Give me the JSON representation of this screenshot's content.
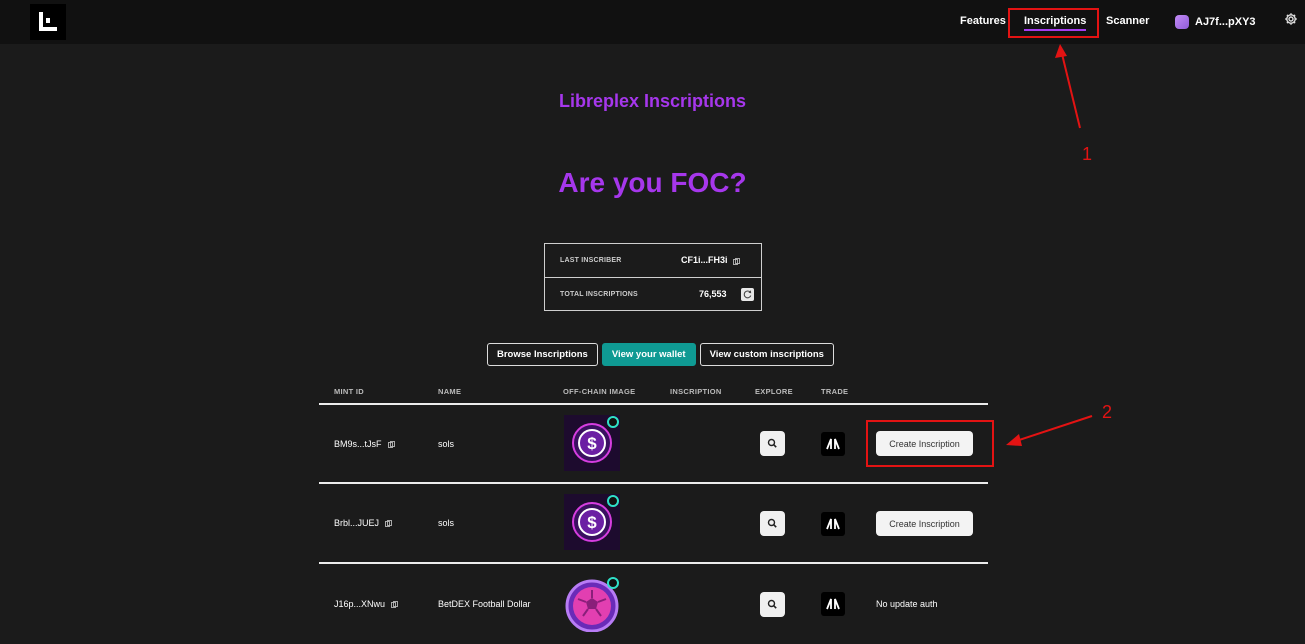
{
  "nav": {
    "features": "Features",
    "inscriptions": "Inscriptions",
    "scanner": "Scanner",
    "wallet": "AJ7f...pXY3"
  },
  "page": {
    "subtitle": "Libreplex Inscriptions",
    "hero": "Are you FOC?"
  },
  "stats": {
    "last_inscriber_label": "LAST INSCRIBER",
    "last_inscriber_value": "CF1i...FH3i",
    "total_label": "TOTAL INSCRIPTIONS",
    "total_value": "76,553"
  },
  "tabs": [
    {
      "label": "Browse Inscriptions"
    },
    {
      "label": "View your wallet"
    },
    {
      "label": "View custom inscriptions"
    }
  ],
  "table": {
    "headers": [
      "MINT ID",
      "NAME",
      "OFF-CHAIN IMAGE",
      "INSCRIPTION",
      "EXPLORE",
      "TRADE"
    ],
    "rows": [
      {
        "mint": "BM9s...tJsF",
        "name": "sols",
        "image": "sols-coin",
        "action": "Create Inscription"
      },
      {
        "mint": "Brbl...JUEJ",
        "name": "sols",
        "image": "sols-coin",
        "action": "Create Inscription"
      },
      {
        "mint": "J16p...XNwu",
        "name": "BetDEX Football Dollar",
        "image": "football-coin",
        "action": "No update auth"
      }
    ]
  },
  "annotations": {
    "label_1": "1",
    "label_2": "2",
    "color": "#e31313"
  },
  "colors": {
    "accent": "#a637ec",
    "active_tab": "#0f9a93",
    "background": "#1b1b1b"
  },
  "icons": [
    "logo-icon",
    "wallet-icon",
    "gear-icon",
    "copy-icon",
    "refresh-icon",
    "search-icon",
    "trade-icon"
  ]
}
